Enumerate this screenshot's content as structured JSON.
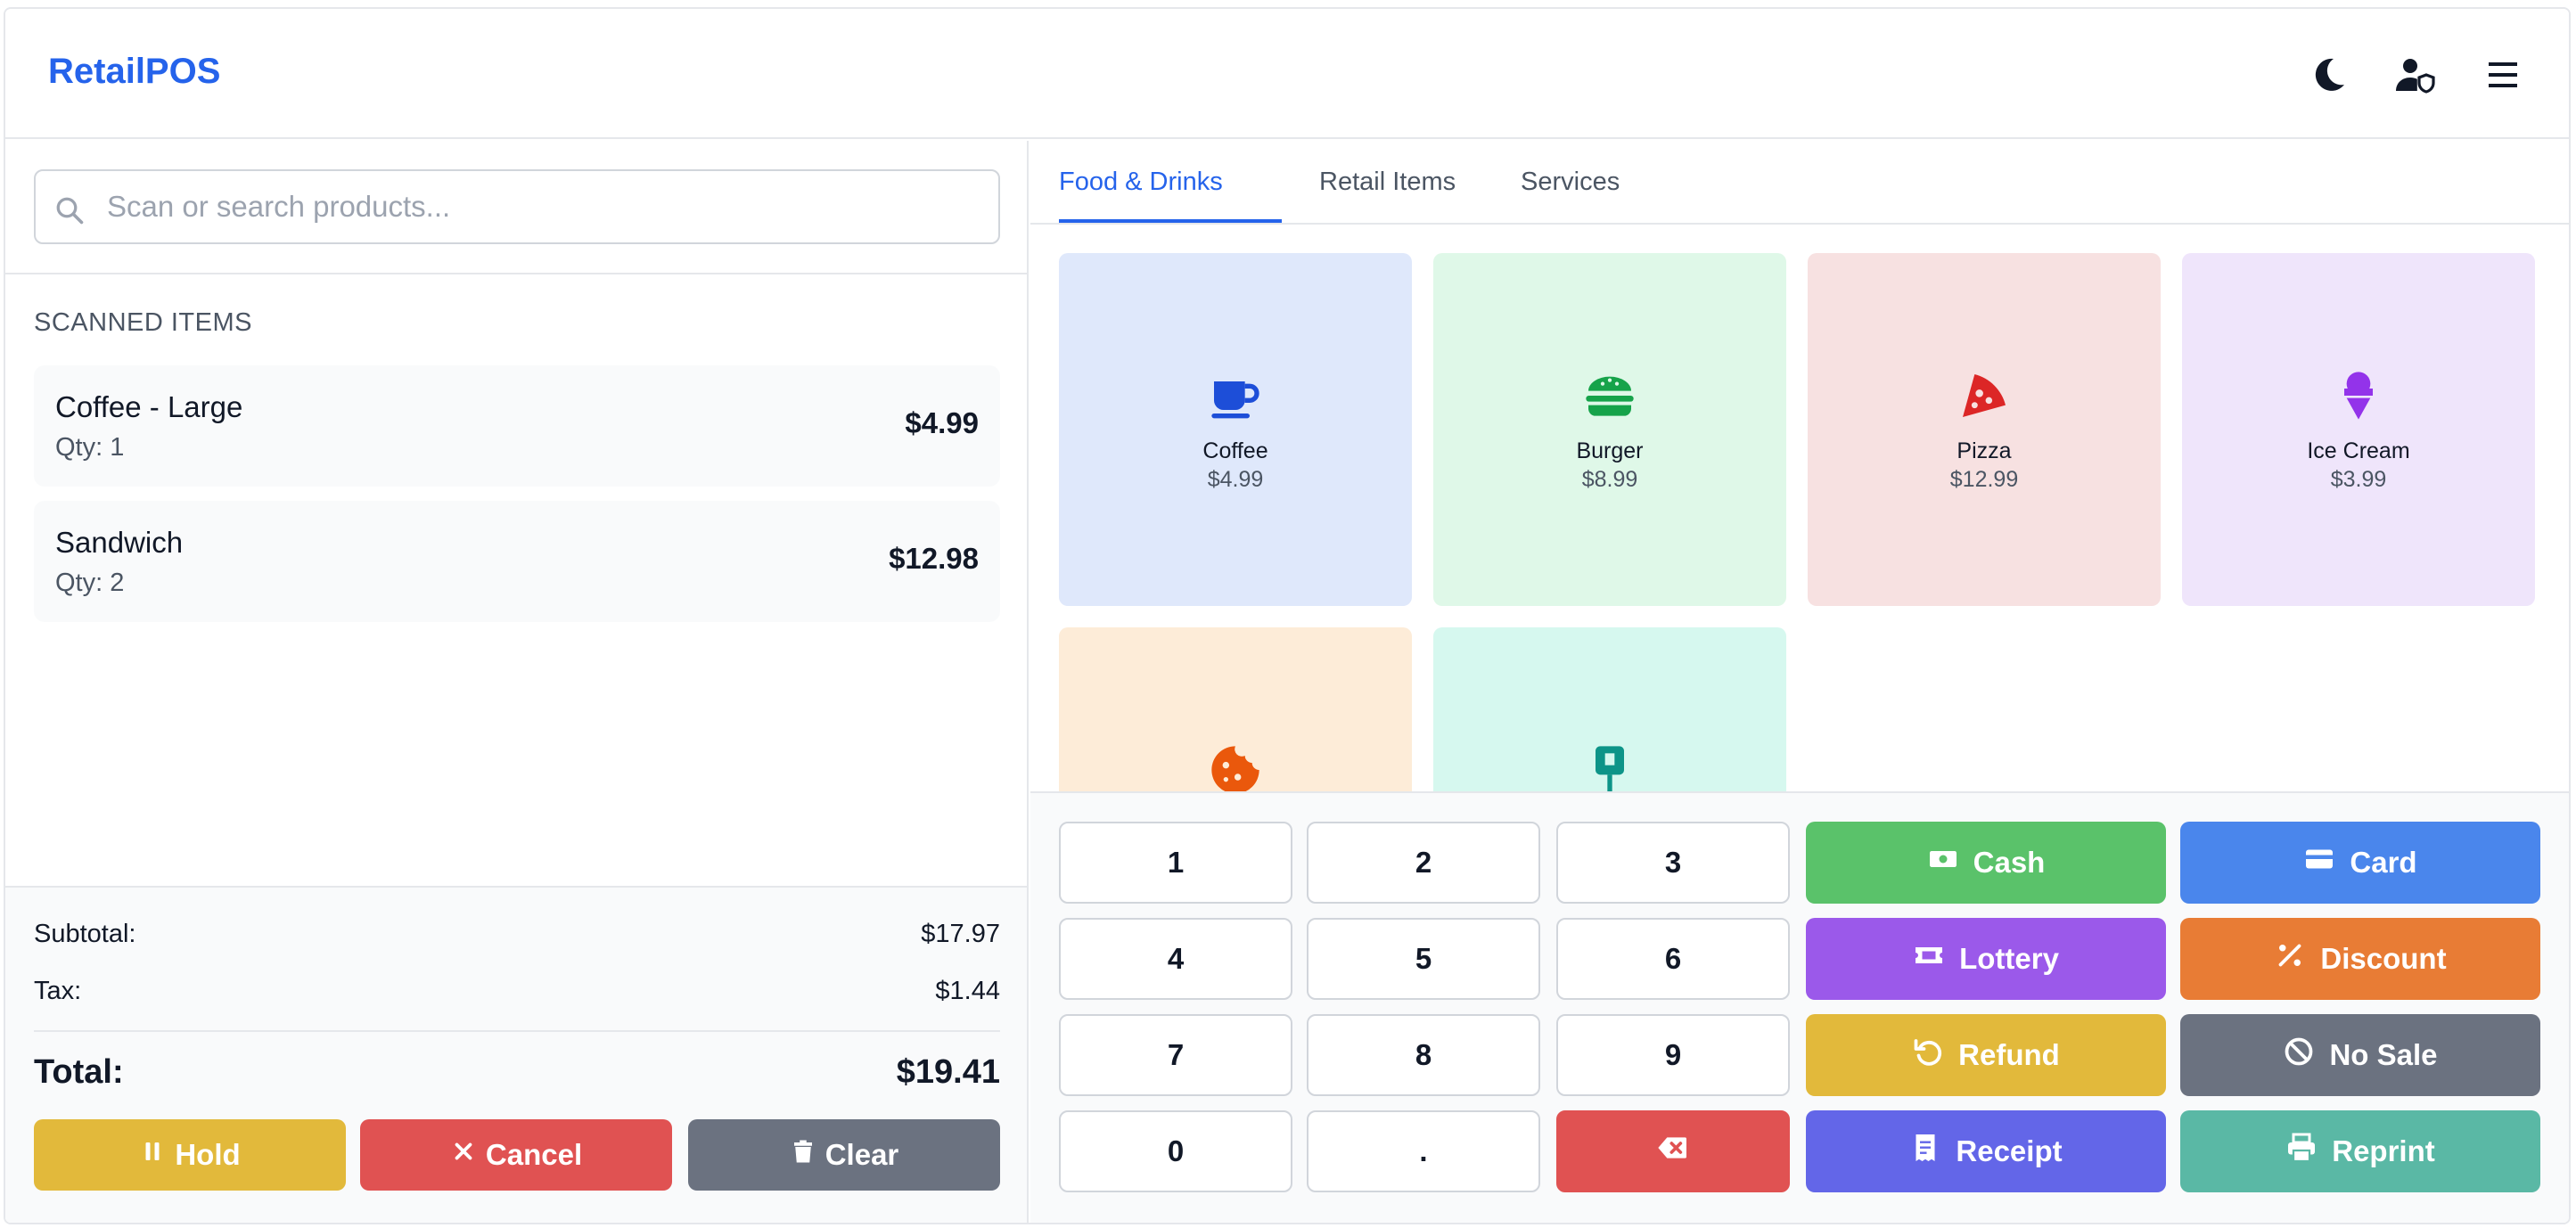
{
  "app": {
    "title": "RetailPOS"
  },
  "header": {
    "icons": [
      "moon-icon",
      "user-shield-icon",
      "menu-icon"
    ]
  },
  "search": {
    "placeholder": "Scan or search products..."
  },
  "cart": {
    "title": "SCANNED ITEMS",
    "items": [
      {
        "name": "Coffee - Large",
        "qty": "Qty: 1",
        "price": "$4.99"
      },
      {
        "name": "Sandwich",
        "qty": "Qty: 2",
        "price": "$12.98"
      }
    ]
  },
  "totals": {
    "subtotal_label": "Subtotal:",
    "subtotal": "$17.97",
    "tax_label": "Tax:",
    "tax": "$1.44",
    "total_label": "Total:",
    "total": "$19.41"
  },
  "actions": {
    "hold": "Hold",
    "cancel": "Cancel",
    "clear": "Clear"
  },
  "tabs": [
    {
      "label": "Food & Drinks",
      "active": true
    },
    {
      "label": "Retail Items",
      "active": false
    },
    {
      "label": "Services",
      "active": false
    }
  ],
  "products": [
    {
      "name": "Coffee",
      "price": "$4.99",
      "icon": "coffee-icon",
      "bg": "#dfe8fb",
      "color": "#1d4ed8"
    },
    {
      "name": "Burger",
      "price": "$8.99",
      "icon": "burger-icon",
      "bg": "#dff8e8",
      "color": "#16a34a"
    },
    {
      "name": "Pizza",
      "price": "$12.99",
      "icon": "pizza-icon",
      "bg": "#f7e1e1",
      "color": "#dc2626"
    },
    {
      "name": "Ice Cream",
      "price": "$3.99",
      "icon": "ice-cream-icon",
      "bg": "#efe5fb",
      "color": "#9333ea"
    },
    {
      "name": "",
      "price": "",
      "icon": "cookie-icon",
      "bg": "#fdecd8",
      "color": "#ea580c"
    },
    {
      "name": "",
      "price": "",
      "icon": "drink-icon",
      "bg": "#d6f8ef",
      "color": "#0d9488"
    }
  ],
  "keypad": [
    "1",
    "2",
    "3",
    "4",
    "5",
    "6",
    "7",
    "8",
    "9",
    "0",
    "."
  ],
  "payments": {
    "cash": "Cash",
    "card": "Card",
    "lottery": "Lottery",
    "discount": "Discount",
    "refund": "Refund",
    "no_sale": "No Sale",
    "receipt": "Receipt",
    "reprint": "Reprint"
  },
  "colors": {
    "brand": "#2563eb",
    "hold": "#e2b93b",
    "cancel": "#e05252",
    "clear": "#6b7280",
    "cash": "#5ac26a",
    "card": "#4a86ec",
    "lottery": "#9b59ea",
    "discount": "#e87c35",
    "refund": "#e2b93b",
    "no_sale": "#6b7280",
    "receipt": "#6366e8",
    "reprint": "#5ab8a5",
    "backspace": "#e05252"
  }
}
